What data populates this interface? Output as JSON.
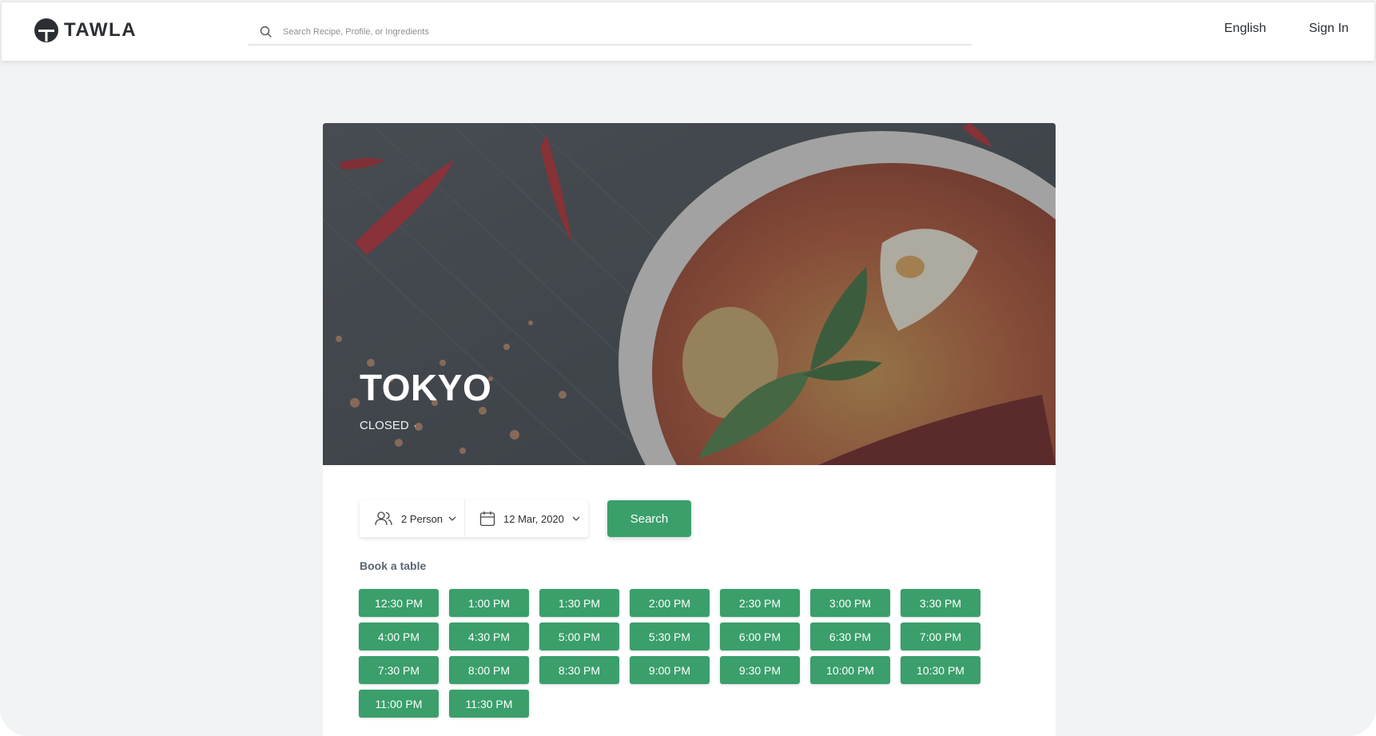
{
  "brand": {
    "name": "TAWLA"
  },
  "search": {
    "placeholder": "Search Recipe, Profile, or Ingredients"
  },
  "nav": {
    "language": "English",
    "sign_in": "Sign In"
  },
  "restaurant": {
    "name": "TOKYO",
    "status": "CLOSED",
    "separator": "·"
  },
  "booking": {
    "guests": "2 Person",
    "date": "12 Mar, 2020",
    "search_label": "Search",
    "section_title": "Book a table",
    "times": [
      "12:30 PM",
      "1:00 PM",
      "1:30 PM",
      "2:00 PM",
      "2:30 PM",
      "3:00 PM",
      "3:30 PM",
      "4:00 PM",
      "4:30 PM",
      "5:00 PM",
      "5:30 PM",
      "6:00 PM",
      "6:30 PM",
      "7:00 PM",
      "7:30 PM",
      "8:00 PM",
      "8:30 PM",
      "9:00 PM",
      "9:30 PM",
      "10:00 PM",
      "10:30 PM",
      "11:00 PM",
      "11:30 PM"
    ]
  },
  "colors": {
    "accent": "#3a9f6b",
    "text": "#2b2f33",
    "background": "#f1f3f4"
  }
}
